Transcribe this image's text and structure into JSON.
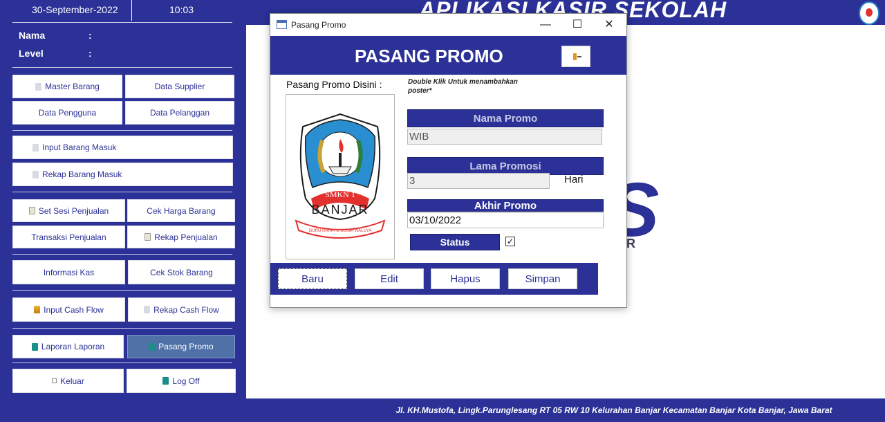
{
  "header": {
    "date": "30-September-2022",
    "time": "10:03",
    "app_title": "APLIKASI KASIR SEKOLAH"
  },
  "user": {
    "nama_label": "Nama",
    "level_label": "Level",
    "colon": ":"
  },
  "sidebar": {
    "master_barang": "Master Barang",
    "data_supplier": "Data Supplier",
    "data_pengguna": "Data Pengguna",
    "data_pelanggan": "Data Pelanggan",
    "input_barang_masuk": "Input Barang Masuk",
    "rekap_barang_masuk": "Rekap Barang Masuk",
    "set_sesi_penjualan": "Set Sesi Penjualan",
    "cek_harga_barang": "Cek Harga Barang",
    "transaksi_penjualan": "Transaksi Penjualan",
    "rekap_penjualan": "Rekap Penjualan",
    "informasi_kas": "Informasi Kas",
    "cek_stok_barang": "Cek Stok Barang",
    "input_cash_flow": "Input Cash Flow",
    "rekap_cash_flow": "Rekap Cash Flow",
    "laporan_laporan": "Laporan Laporan",
    "pasang_promo": "Pasang Promo",
    "keluar": "Keluar",
    "log_off": "Log Off"
  },
  "background": {
    "partial_letter": "S",
    "partial_text": "R"
  },
  "footer": {
    "address": "Jl. KH.Mustofa, Lingk.Parunglesang RT 05 RW 10 Kelurahan Banjar Kecamatan Banjar Kota Banjar, Jawa Barat"
  },
  "dialog": {
    "window_title": "Pasang Promo",
    "heading": "PASANG PROMO",
    "poster_label": "Pasang Promo Disini :",
    "hint": "Double Klik Untuk menambahkan poster*",
    "poster": {
      "school_name": "SMKN 1",
      "city": "BANJAR",
      "motto": "GURU RAHAYU SISWA WALUYA"
    },
    "fields": {
      "nama_promo_label": "Nama Promo",
      "nama_promo_value": "WIB",
      "lama_promosi_label": "Lama Promosi",
      "lama_promosi_value": "3",
      "hari_label": "Hari",
      "akhir_promo_label": "Akhir Promo",
      "akhir_promo_value": "03/10/2022",
      "status_label": "Status",
      "status_checked": true,
      "checkmark": "✓"
    },
    "buttons": {
      "baru": "Baru",
      "edit": "Edit",
      "hapus": "Hapus",
      "simpan": "Simpan"
    },
    "window_controls": {
      "minimize": "—",
      "maximize": "☐",
      "close": "✕"
    }
  },
  "colors": {
    "primary": "#2b3196",
    "active_button": "#4f71a8"
  }
}
